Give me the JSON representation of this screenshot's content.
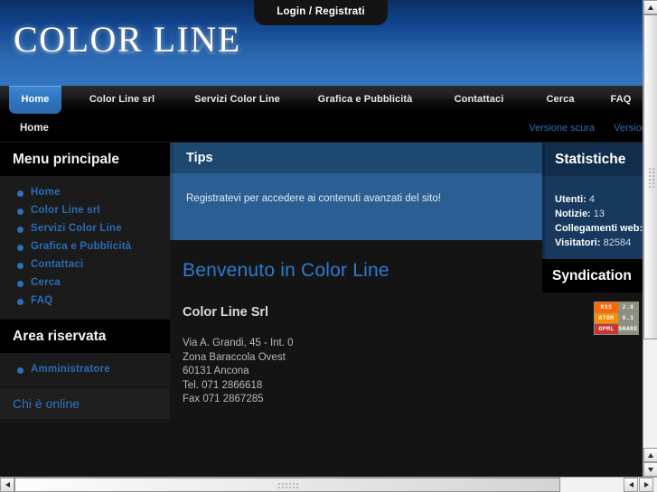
{
  "header": {
    "login_tab": "Login / Registrati",
    "logo_text": "COLOR LINE"
  },
  "nav": {
    "items": [
      {
        "label": "Home",
        "active": true
      },
      {
        "label": "Color Line srl",
        "active": false
      },
      {
        "label": "Servizi Color Line",
        "active": false
      },
      {
        "label": "Grafica e Pubblicità",
        "active": false
      },
      {
        "label": "Contattaci",
        "active": false
      },
      {
        "label": "Cerca",
        "active": false
      },
      {
        "label": "FAQ",
        "active": false
      }
    ]
  },
  "pathway": {
    "crumb": "Home",
    "skin_dark": "Versione scura",
    "skin_light": "Versione chiara"
  },
  "sidebar_left": {
    "main_menu": {
      "title": "Menu principale",
      "items": [
        {
          "label": "Home"
        },
        {
          "label": "Color Line srl"
        },
        {
          "label": "Servizi Color Line"
        },
        {
          "label": "Grafica e Pubblicità"
        },
        {
          "label": "Contattaci"
        },
        {
          "label": "Cerca"
        },
        {
          "label": "FAQ"
        }
      ]
    },
    "reserved_area": {
      "title": "Area riservata",
      "items": [
        {
          "label": "Amministratore"
        }
      ]
    },
    "who_is_online": {
      "title": "Chi è online"
    }
  },
  "main": {
    "tips": {
      "title": "Tips",
      "text": "Registratevi per accedere ai contenuti avanzati del sito!"
    },
    "welcome_title": "Benvenuto in Color Line",
    "company_name": "Color Line Srl",
    "address": [
      "Via A. Grandi, 45 - Int. 0",
      "Zona Baraccola Ovest",
      "60131 Ancona",
      "Tel. 071 2866618",
      "Fax 071 2867285"
    ]
  },
  "sidebar_right": {
    "stats": {
      "title": "Statistiche",
      "rows": [
        {
          "label": "Utenti:",
          "value": "4"
        },
        {
          "label": "Notizie:",
          "value": "13"
        },
        {
          "label": "Collegamenti web:",
          "value": ""
        },
        {
          "label": "Visitatori:",
          "value": "82584"
        }
      ]
    },
    "syndication": {
      "title": "Syndication",
      "badges": [
        {
          "left": "RSS",
          "right": "2.0"
        },
        {
          "left": "ATOM",
          "right": "0.3"
        },
        {
          "left": "OPML",
          "right": "SHARE"
        }
      ]
    }
  },
  "colors": {
    "accent_blue": "#2e7ad0",
    "link_blue": "#2b6cb5",
    "panel_dark": "#141414",
    "header_top": "#0a2f63",
    "header_bottom": "#3275c0"
  }
}
